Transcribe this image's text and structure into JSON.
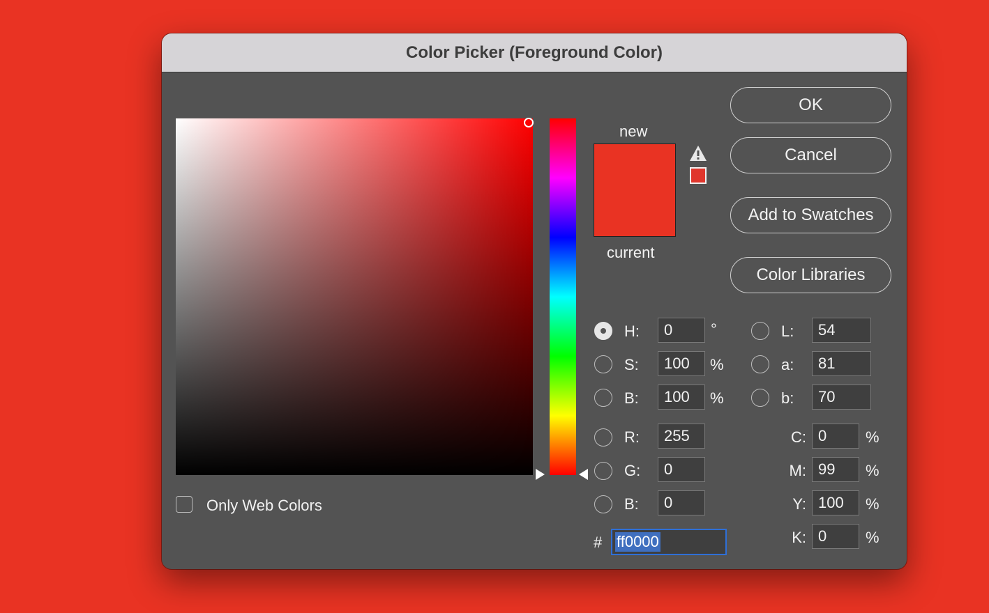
{
  "dialog": {
    "title": "Color Picker (Foreground Color)"
  },
  "swatch": {
    "new_label": "new",
    "current_label": "current",
    "new_color": "#e93323",
    "current_color": "#e93323",
    "gamut_color": "#e0362c"
  },
  "buttons": {
    "ok": "OK",
    "cancel": "Cancel",
    "add_to_swatches": "Add to Swatches",
    "color_libraries": "Color Libraries"
  },
  "hsb": {
    "h_label": "H:",
    "h_value": "0",
    "h_unit": "°",
    "s_label": "S:",
    "s_value": "100",
    "s_unit": "%",
    "b_label": "B:",
    "b_value": "100",
    "b_unit": "%"
  },
  "lab": {
    "l_label": "L:",
    "l_value": "54",
    "a_label": "a:",
    "a_value": "81",
    "b_label": "b:",
    "b_value": "70"
  },
  "rgb": {
    "r_label": "R:",
    "r_value": "255",
    "g_label": "G:",
    "g_value": "0",
    "b_label": "B:",
    "b_value": "0"
  },
  "cmyk": {
    "c_label": "C:",
    "c_value": "0",
    "c_unit": "%",
    "m_label": "M:",
    "m_value": "99",
    "m_unit": "%",
    "y_label": "Y:",
    "y_value": "100",
    "y_unit": "%",
    "k_label": "K:",
    "k_value": "0",
    "k_unit": "%"
  },
  "hex": {
    "hash": "#",
    "value": "ff0000"
  },
  "only_web_colors": {
    "label": "Only Web Colors",
    "checked": false
  },
  "selected_mode": "H",
  "colors": {
    "background": "#e93323",
    "dialog_bg": "#535353",
    "titlebar_bg": "#d6d4d7",
    "hex_focus": "#2f6fd6"
  },
  "icons": {
    "gamut_warning": "warning-triangle-icon",
    "hue_slider_left": "triangle-right-icon",
    "hue_slider_right": "triangle-left-icon"
  }
}
